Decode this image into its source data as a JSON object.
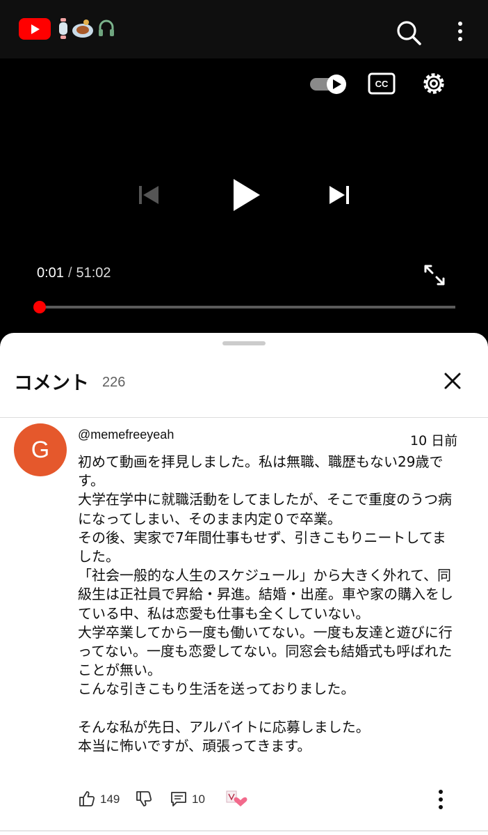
{
  "topbar": {
    "logo_icon": "youtube-logo-icon",
    "decor_icons": [
      "rolling-pin-icon",
      "teapot-icon",
      "headphones-icon"
    ]
  },
  "player": {
    "current_time": "0:01",
    "time_separator": "/",
    "duration": "51:02",
    "progress_fraction": 0.0003,
    "colors": {
      "accent": "#ff0000"
    }
  },
  "comments": {
    "title": "コメント",
    "count": "226",
    "items": [
      {
        "avatar_letter": "G",
        "avatar_color": "#e5582c",
        "author": "@memefreeyeah",
        "date": "10 日前",
        "text": "初めて動画を拝見しました。私は無職、職歴もない29歳です。\n大学在学中に就職活動をしてましたが、そこで重度のうつ病になってしまい、そのまま内定０で卒業。\nその後、実家で7年間仕事もせず、引きこもりニートしてました。\n「社会一般的な人生のスケジュール」から大きく外れて、同級生は正社員で昇給・昇進。結婚・出産。車や家の購入をしている中、私は恋愛も仕事も全くしていない。\n大学卒業してから一度も働いてない。一度も友達と遊びに行ってない。一度も恋愛してない。同窓会も結婚式も呼ばれたことが無い。\nこんな引きこもり生活を送っておりました。\n\nそんな私が先日、アルバイトに応募しました。\n本当に怖いですが、頑張ってきます。",
        "likes": "149",
        "replies": "10"
      }
    ]
  }
}
